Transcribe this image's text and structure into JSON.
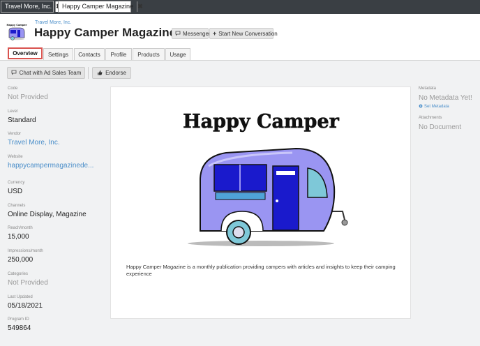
{
  "window_tabs": [
    {
      "label": "Travel More, Inc."
    },
    {
      "label": "Happy Camper Magazine"
    }
  ],
  "header": {
    "breadcrumb": "Travel More, Inc.",
    "title": "Happy Camper Magazine",
    "logo_text": "Happy Camper",
    "messenger_label": "Messenger",
    "new_conversation_label": "Start New Conversation"
  },
  "nav_tabs": [
    "Overview",
    "Settings",
    "Contacts",
    "Profile",
    "Products",
    "Usage"
  ],
  "actions": {
    "chat_label": "Chat with Ad Sales Team",
    "endorse_label": "Endorse"
  },
  "fields": [
    {
      "label": "Code",
      "value": "Not Provided"
    },
    {
      "label": "Level",
      "value": "Standard"
    },
    {
      "label": "Vendor",
      "value": "Travel More, Inc."
    },
    {
      "label": "Website",
      "value": "happycampermagazinede..."
    },
    {
      "label": "Currency",
      "value": "USD"
    },
    {
      "label": "Channels",
      "value": "Online Display, Magazine"
    },
    {
      "label": "Reach/month",
      "value": "15,000"
    },
    {
      "label": "Impressions/month",
      "value": "250,000"
    },
    {
      "label": "Categories",
      "value": "Not Provided"
    },
    {
      "label": "Last Updated",
      "value": "05/18/2021"
    },
    {
      "label": "Program ID",
      "value": "549864"
    }
  ],
  "card": {
    "image_title": "Happy Camper",
    "description": "Happy Camper Magazine is a monthly publication providing campers with articles and insights to keep their camping experience"
  },
  "right_panel": {
    "metadata_label": "Metadata",
    "metadata_value": "No Metadata Yet!",
    "set_metadata_label": "Set Metadata",
    "attachments_label": "Attachments",
    "attachments_value": "No Document"
  },
  "colors": {
    "accent": "#4a8ec9",
    "active_tab_border": "#d9534f",
    "camper_body": "#9a95f2",
    "camper_dark": "#1a1acc"
  },
  "icons": [
    "close-icon",
    "chat-bubble-icon",
    "plus-icon",
    "thumbs-up-icon",
    "gear-icon"
  ]
}
